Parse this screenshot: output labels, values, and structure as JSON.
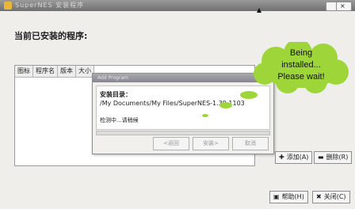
{
  "window": {
    "title": "SuperNES 安装程序"
  },
  "main": {
    "installed_label": "当前已安装的程序:",
    "columns": [
      "图标",
      "程序名",
      "版本",
      "大小"
    ]
  },
  "dialog": {
    "title": "Add Program",
    "dir_label": "安装目录：",
    "dir_path": "/My Documents/My Files/SuperNES-1.39.1103",
    "status": "检测中...请稍候",
    "buttons": {
      "back": "<返回",
      "install": "安装>",
      "cancel": "取消"
    }
  },
  "bubble": {
    "line1": "Being",
    "line2": "installed...",
    "line3": "Please wait!",
    "color": "#9ed63a"
  },
  "actions": {
    "add": "添加(A)",
    "delete": "删除(R)",
    "help": "帮助(H)",
    "close": "关闭(C)"
  }
}
